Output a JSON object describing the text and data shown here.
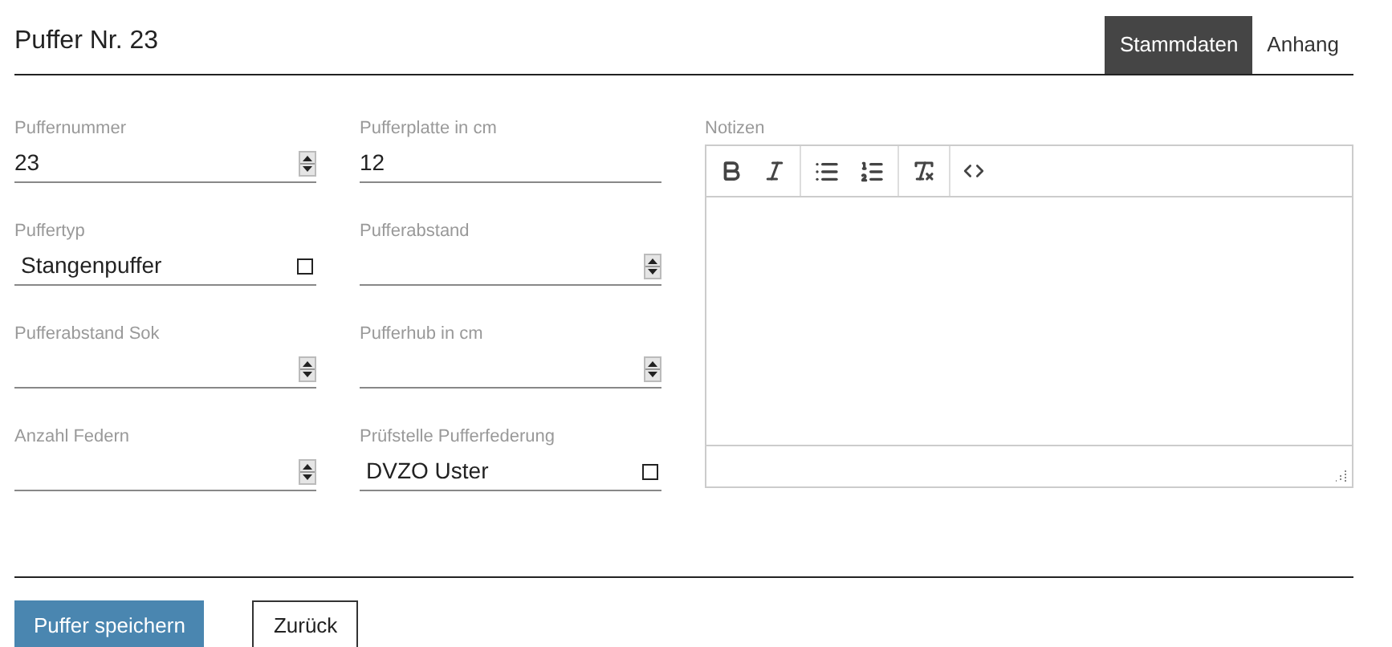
{
  "header": {
    "title": "Puffer Nr. 23"
  },
  "tabs": [
    {
      "label": "Stammdaten",
      "selected": true
    },
    {
      "label": "Anhang",
      "selected": false
    }
  ],
  "columns": [
    [
      {
        "label": "Puffernummer",
        "kind": "number",
        "value": "23"
      },
      {
        "label": "Puffertyp",
        "kind": "select",
        "value": "Stangenpuffer"
      },
      {
        "label": "Pufferabstand Sok",
        "kind": "number"
      },
      {
        "label": "Anzahl Federn",
        "kind": "number"
      }
    ],
    [
      {
        "label": "Pufferplatte in cm",
        "kind": "text",
        "value": "12"
      },
      {
        "label": "Pufferabstand",
        "kind": "number"
      },
      {
        "label": "Pufferhub in cm",
        "kind": "number"
      },
      {
        "label": "Prüfstelle Pufferfederung",
        "kind": "select",
        "value": "DVZO Uster"
      }
    ]
  ],
  "notes": {
    "label": "Notizen"
  },
  "buttons": [
    {
      "label": "Puffer speichern",
      "kind": "primary"
    },
    {
      "label": "Zurück",
      "kind": "secondary"
    }
  ]
}
